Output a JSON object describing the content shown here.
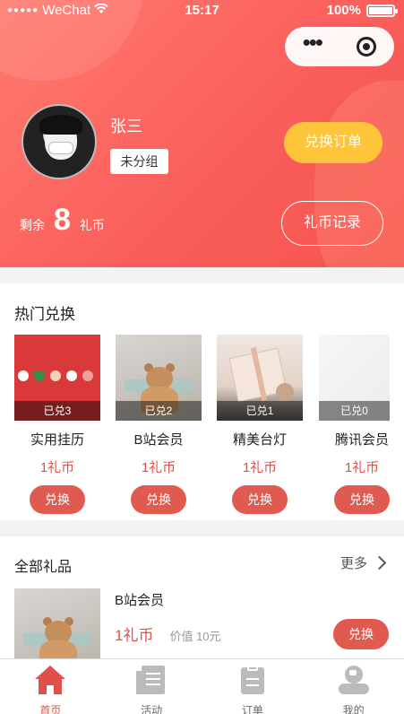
{
  "status_bar": {
    "carrier": "WeChat",
    "time": "15:17",
    "battery": "100%"
  },
  "profile": {
    "name": "张三",
    "group": "未分组",
    "balance_prefix": "剩余",
    "balance": "8",
    "balance_unit": "礼币",
    "orders_button": "兑换订单",
    "record_button": "礼币记录"
  },
  "hot": {
    "title": "热门兑换",
    "items": [
      {
        "name": "实用挂历",
        "exchanged": "已兑3",
        "price": "1礼币",
        "button": "兑换"
      },
      {
        "name": "B站会员",
        "exchanged": "已兑2",
        "price": "1礼币",
        "button": "兑换"
      },
      {
        "name": "精美台灯",
        "exchanged": "已兑1",
        "price": "1礼币",
        "button": "兑换"
      },
      {
        "name": "腾讯会员",
        "exchanged": "已兑0",
        "price": "1礼币",
        "button": "兑换"
      }
    ]
  },
  "all_gifts": {
    "title": "全部礼品",
    "more": "更多",
    "items": [
      {
        "name": "B站会员",
        "price": "1礼币",
        "value": "价值 10元",
        "button": "兑换"
      }
    ]
  },
  "tabbar": {
    "items": [
      {
        "label": "首页",
        "icon": "home-icon",
        "active": true
      },
      {
        "label": "活动",
        "icon": "activity-icon",
        "active": false
      },
      {
        "label": "订单",
        "icon": "order-icon",
        "active": false
      },
      {
        "label": "我的",
        "icon": "user-icon",
        "active": false
      }
    ]
  },
  "colors": {
    "primary": "#fa5d5a",
    "accent": "#fec53a",
    "price": "#e0504a",
    "button": "#e05a50"
  }
}
